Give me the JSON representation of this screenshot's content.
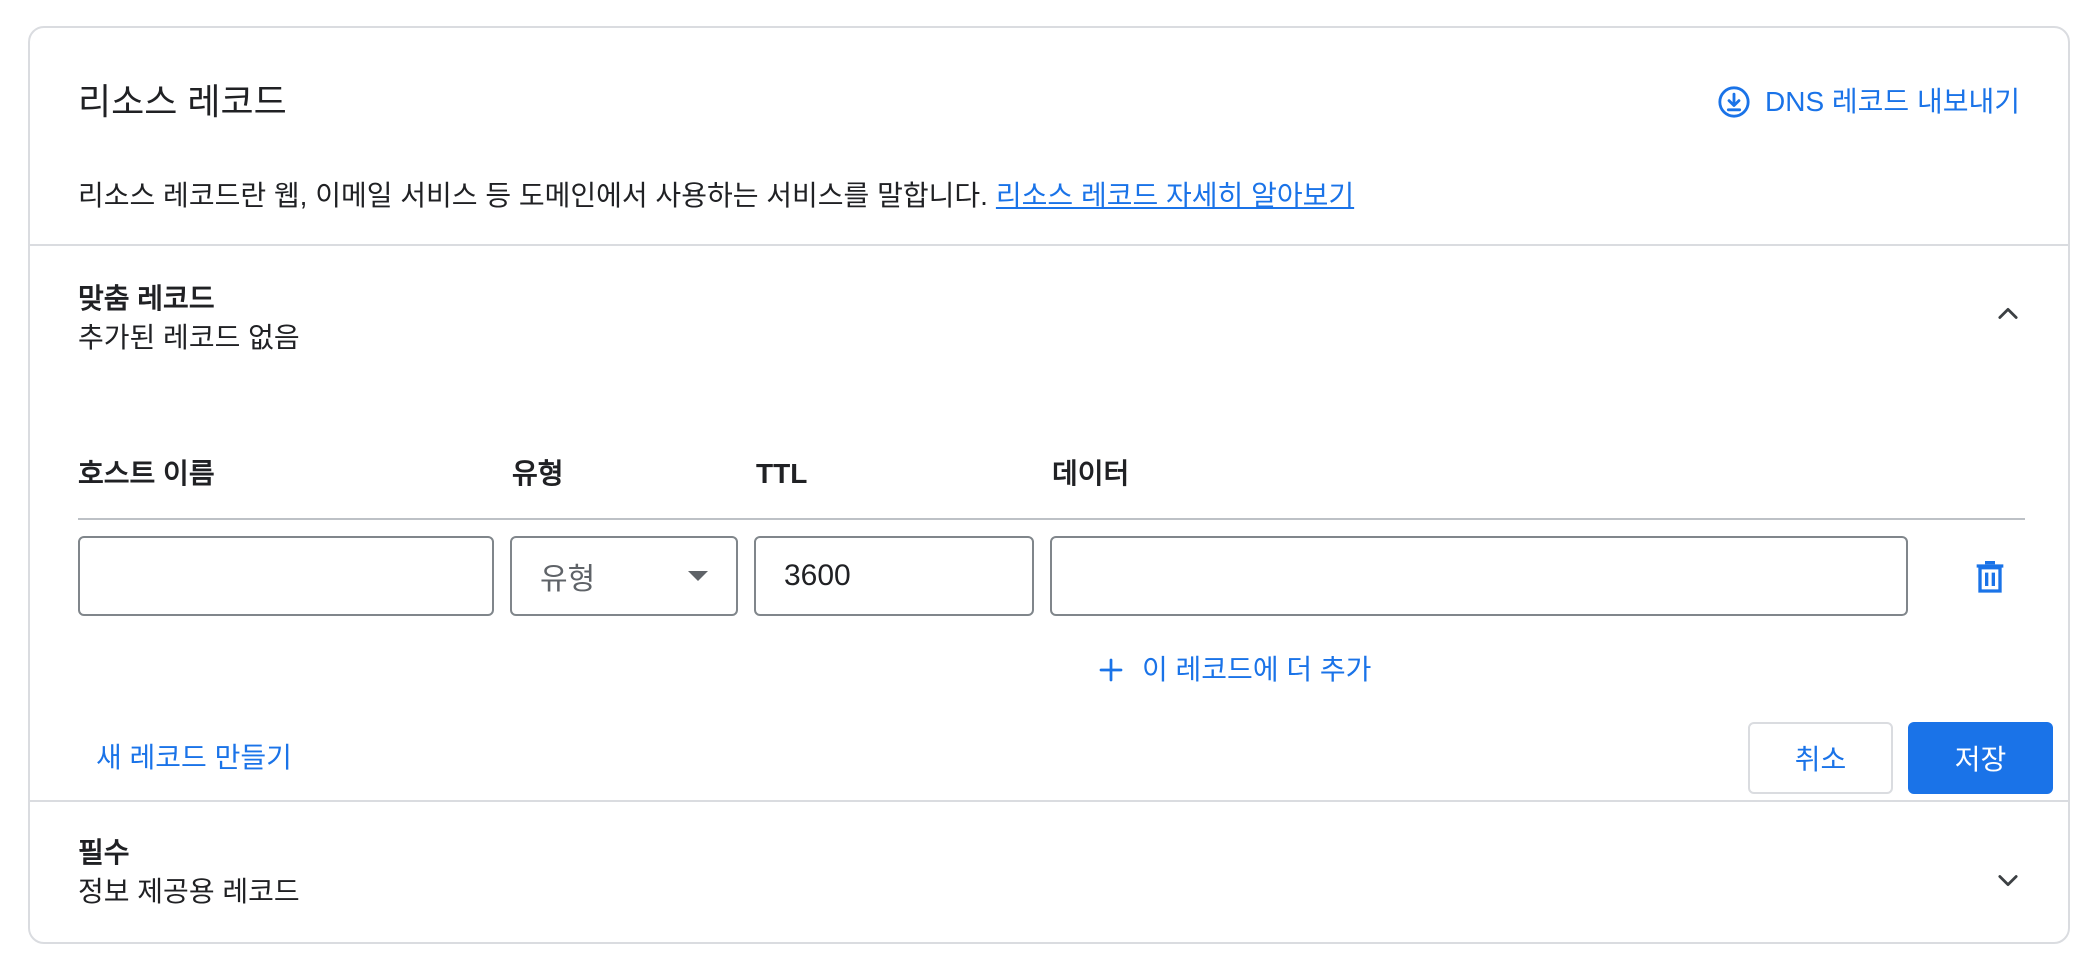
{
  "header": {
    "title": "리소스 레코드",
    "export_label": "DNS 레코드 내보내기",
    "description": "리소스 레코드란 웹, 이메일 서비스 등 도메인에서 사용하는 서비스를 말합니다.",
    "learn_more_link": "리소스 레코드 자세히 알아보기"
  },
  "custom_records": {
    "title": "맞춤 레코드",
    "subtitle": "추가된 레코드 없음",
    "expanded": true,
    "columns": {
      "host": "호스트 이름",
      "type": "유형",
      "ttl": "TTL",
      "data": "데이터"
    },
    "row": {
      "host_value": "",
      "type_placeholder": "유형",
      "ttl_value": "3600",
      "data_value": ""
    },
    "add_more_label": "이 레코드에 더 추가",
    "new_record_label": "새 레코드 만들기",
    "cancel_label": "취소",
    "save_label": "저장"
  },
  "required_records": {
    "title": "필수",
    "subtitle": "정보 제공용 레코드",
    "expanded": false
  },
  "icons": {
    "export": "download-circle-icon",
    "collapse": "chevron-up-icon",
    "expand": "chevron-down-icon",
    "delete": "trash-icon",
    "add": "plus-icon",
    "dropdown": "caret-down-icon"
  },
  "colors": {
    "accent": "#1a73e8",
    "border": "#dadce0",
    "text": "#202124"
  }
}
